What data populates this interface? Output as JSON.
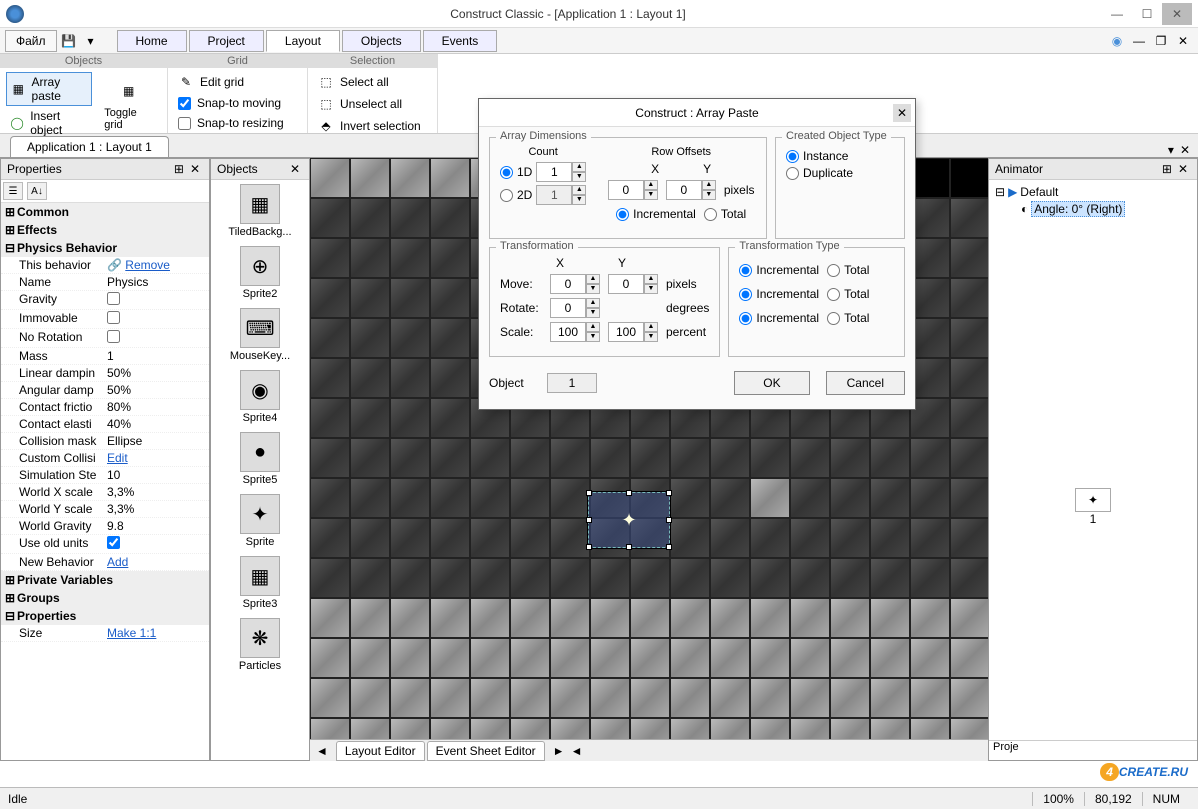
{
  "titlebar": {
    "title": "Construct Classic - [Application 1 : Layout 1]"
  },
  "menubar": {
    "file": "Файл",
    "tabs": [
      "Home",
      "Project",
      "Layout",
      "Objects",
      "Events"
    ],
    "active_tab": 2
  },
  "ribbon": {
    "groups": {
      "objects": {
        "label": "Objects",
        "array_paste": "Array paste",
        "insert_object": "Insert object"
      },
      "grid": {
        "label": "Grid",
        "toggle_grid": "Toggle grid",
        "edit_grid": "Edit grid",
        "snap_move": "Snap-to moving",
        "snap_resize": "Snap-to resizing"
      },
      "selection": {
        "label": "Selection",
        "select_all": "Select all",
        "unselect_all": "Unselect all",
        "invert": "Invert selection"
      }
    }
  },
  "doctabs": {
    "tab1": "Application 1 : Layout 1"
  },
  "properties": {
    "title": "Properties",
    "cats": {
      "common": "Common",
      "effects": "Effects",
      "physics": "Physics Behavior",
      "private_vars": "Private Variables",
      "groups": "Groups",
      "props": "Properties"
    },
    "rows": {
      "this_behavior": {
        "k": "This behavior",
        "v": "Remove",
        "link": true
      },
      "name": {
        "k": "Name",
        "v": "Physics"
      },
      "gravity": {
        "k": "Gravity",
        "v": "",
        "check": false
      },
      "immovable": {
        "k": "Immovable",
        "v": "",
        "check": false
      },
      "no_rotation": {
        "k": "No Rotation",
        "v": "",
        "check": false
      },
      "mass": {
        "k": "Mass",
        "v": "1"
      },
      "linear_damp": {
        "k": "Linear dampin",
        "v": "50%"
      },
      "angular_damp": {
        "k": "Angular damp",
        "v": "50%"
      },
      "contact_fric": {
        "k": "Contact frictio",
        "v": "80%"
      },
      "contact_elas": {
        "k": "Contact elasti",
        "v": "40%"
      },
      "collision_mask": {
        "k": "Collision mask",
        "v": "Ellipse"
      },
      "custom_coll": {
        "k": "Custom Collisi",
        "v": "Edit",
        "link": true
      },
      "sim_step": {
        "k": "Simulation Ste",
        "v": "10"
      },
      "world_x": {
        "k": "World X scale",
        "v": "3,3%"
      },
      "world_y": {
        "k": "World Y scale",
        "v": "3,3%"
      },
      "world_grav": {
        "k": "World Gravity",
        "v": "9.8"
      },
      "old_units": {
        "k": "Use old units",
        "v": "",
        "check": true
      },
      "new_behav": {
        "k": "New Behavior",
        "v": "Add",
        "link": true
      },
      "size": {
        "k": "Size",
        "v": "Make 1:1",
        "link": true
      }
    }
  },
  "objects": {
    "title": "Objects",
    "items": [
      {
        "label": "TiledBackg...",
        "glyph": "▦"
      },
      {
        "label": "Sprite2",
        "glyph": "⊕"
      },
      {
        "label": "MouseKey...",
        "glyph": "⌨"
      },
      {
        "label": "Sprite4",
        "glyph": "◉"
      },
      {
        "label": "Sprite5",
        "glyph": "●"
      },
      {
        "label": "Sprite",
        "glyph": "✦"
      },
      {
        "label": "Sprite3",
        "glyph": "▦"
      },
      {
        "label": "Particles",
        "glyph": "❋"
      }
    ]
  },
  "canvas": {
    "tabs": {
      "layout": "Layout Editor",
      "event": "Event Sheet Editor"
    }
  },
  "animator": {
    "title": "Animator",
    "default": "Default",
    "angle": "Angle: 0° (Right)",
    "frame1": "1",
    "bottom_tab": "Proje"
  },
  "modal": {
    "title": "Construct : Array Paste",
    "array_dims": "Array Dimensions",
    "count": "Count",
    "d1": "1D",
    "d2": "2D",
    "count1": "1",
    "count2": "1",
    "row_offsets": "Row Offsets",
    "x": "X",
    "y": "Y",
    "rox": "0",
    "roy": "0",
    "pixels": "pixels",
    "incremental": "Incremental",
    "total": "Total",
    "created_type": "Created Object Type",
    "instance": "Instance",
    "duplicate": "Duplicate",
    "transformation": "Transformation",
    "move": "Move:",
    "rotate": "Rotate:",
    "scale": "Scale:",
    "mv_x": "0",
    "mv_y": "0",
    "rot": "0",
    "degrees": "degrees",
    "sc_x": "100",
    "sc_y": "100",
    "percent": "percent",
    "trans_type": "Transformation Type",
    "object": "Object",
    "object_val": "1",
    "ok": "OK",
    "cancel": "Cancel"
  },
  "statusbar": {
    "idle": "Idle",
    "zoom": "100%",
    "coords": "80,192",
    "num": "NUM"
  },
  "logo": {
    "four": "4",
    "rest": "CREATE.RU"
  }
}
